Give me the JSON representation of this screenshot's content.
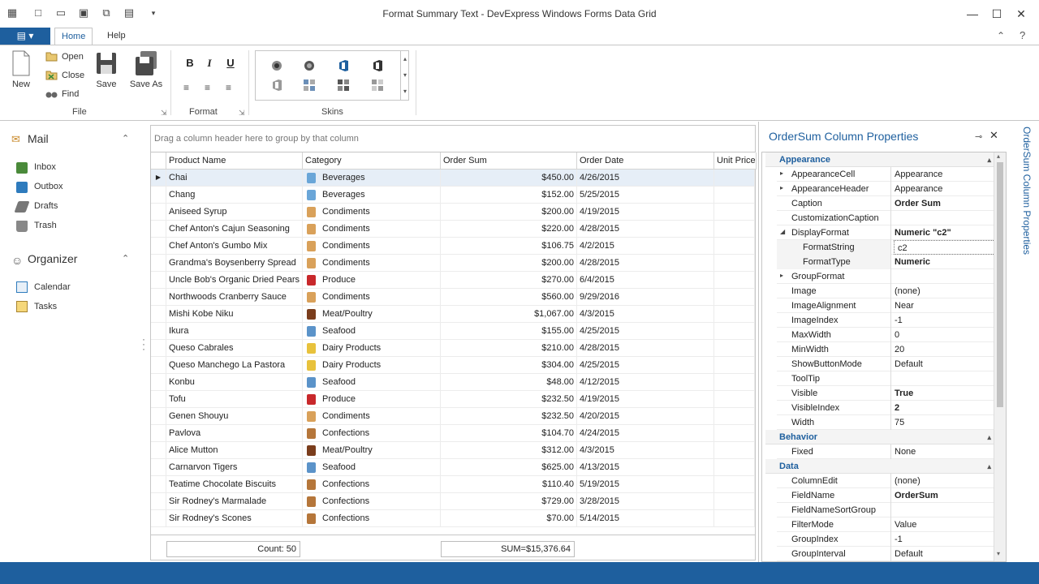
{
  "window": {
    "title": "Format Summary Text - DevExpress Windows Forms Data Grid"
  },
  "ribbon": {
    "file_label": "▤ ▾",
    "tabs": [
      "Home",
      "Help"
    ],
    "new_label": "New",
    "open_label": "Open",
    "close_label": "Close",
    "find_label": "Find",
    "save_label": "Save",
    "saveas_label": "Save As",
    "groups": {
      "file": "File",
      "format": "Format",
      "skins": "Skins"
    },
    "format_buttons": [
      "B",
      "I",
      "U"
    ]
  },
  "nav": {
    "mail": {
      "header": "Mail",
      "items": [
        "Inbox",
        "Outbox",
        "Drafts",
        "Trash"
      ]
    },
    "organizer": {
      "header": "Organizer",
      "items": [
        "Calendar",
        "Tasks"
      ]
    }
  },
  "grid": {
    "group_panel_text": "Drag a column header here to group by that column",
    "columns": [
      "Product Name",
      "Category",
      "Order Sum",
      "Order Date",
      "Unit Price"
    ],
    "rows": [
      {
        "name": "Chai",
        "category": "Beverages",
        "sum": "$450.00",
        "date": "4/26/2015"
      },
      {
        "name": "Chang",
        "category": "Beverages",
        "sum": "$152.00",
        "date": "5/25/2015"
      },
      {
        "name": "Aniseed Syrup",
        "category": "Condiments",
        "sum": "$200.00",
        "date": "4/19/2015"
      },
      {
        "name": "Chef Anton's Cajun Seasoning",
        "category": "Condiments",
        "sum": "$220.00",
        "date": "4/28/2015"
      },
      {
        "name": "Chef Anton's Gumbo Mix",
        "category": "Condiments",
        "sum": "$106.75",
        "date": "4/2/2015"
      },
      {
        "name": "Grandma's Boysenberry Spread",
        "category": "Condiments",
        "sum": "$200.00",
        "date": "4/28/2015"
      },
      {
        "name": "Uncle Bob's Organic Dried Pears",
        "category": "Produce",
        "sum": "$270.00",
        "date": "6/4/2015"
      },
      {
        "name": "Northwoods Cranberry Sauce",
        "category": "Condiments",
        "sum": "$560.00",
        "date": "9/29/2016"
      },
      {
        "name": "Mishi Kobe Niku",
        "category": "Meat/Poultry",
        "sum": "$1,067.00",
        "date": "4/3/2015"
      },
      {
        "name": "Ikura",
        "category": "Seafood",
        "sum": "$155.00",
        "date": "4/25/2015"
      },
      {
        "name": "Queso Cabrales",
        "category": "Dairy Products",
        "sum": "$210.00",
        "date": "4/28/2015"
      },
      {
        "name": "Queso Manchego La Pastora",
        "category": "Dairy Products",
        "sum": "$304.00",
        "date": "4/25/2015"
      },
      {
        "name": "Konbu",
        "category": "Seafood",
        "sum": "$48.00",
        "date": "4/12/2015"
      },
      {
        "name": "Tofu",
        "category": "Produce",
        "sum": "$232.50",
        "date": "4/19/2015"
      },
      {
        "name": "Genen Shouyu",
        "category": "Condiments",
        "sum": "$232.50",
        "date": "4/20/2015"
      },
      {
        "name": "Pavlova",
        "category": "Confections",
        "sum": "$104.70",
        "date": "4/24/2015"
      },
      {
        "name": "Alice Mutton",
        "category": "Meat/Poultry",
        "sum": "$312.00",
        "date": "4/3/2015"
      },
      {
        "name": "Carnarvon Tigers",
        "category": "Seafood",
        "sum": "$625.00",
        "date": "4/13/2015"
      },
      {
        "name": "Teatime Chocolate Biscuits",
        "category": "Confections",
        "sum": "$110.40",
        "date": "5/19/2015"
      },
      {
        "name": "Sir Rodney's Marmalade",
        "category": "Confections",
        "sum": "$729.00",
        "date": "3/28/2015"
      },
      {
        "name": "Sir Rodney's Scones",
        "category": "Confections",
        "sum": "$70.00",
        "date": "5/14/2015"
      }
    ],
    "footer": {
      "count": "Count: 50",
      "sum": "SUM=$15,376.64"
    },
    "category_colors": {
      "Beverages": "#6aa6d8",
      "Condiments": "#d9a15a",
      "Produce": "#c8282b",
      "Meat/Poultry": "#7a3d1c",
      "Seafood": "#5b93c9",
      "Dairy Products": "#e8c23c",
      "Confections": "#b5763a"
    }
  },
  "props": {
    "title": "OrderSum Column Properties",
    "vertical_tab": "OrderSum Column Properties",
    "categories": {
      "appearance": "Appearance",
      "behavior": "Behavior",
      "data": "Data"
    },
    "appearance_rows": [
      {
        "name": "AppearanceCell",
        "value": "Appearance",
        "bold": false,
        "expander": "▸"
      },
      {
        "name": "AppearanceHeader",
        "value": "Appearance",
        "bold": false,
        "expander": "▸"
      },
      {
        "name": "Caption",
        "value": "Order Sum",
        "bold": true,
        "expander": ""
      },
      {
        "name": "CustomizationCaption",
        "value": "",
        "bold": false,
        "expander": ""
      },
      {
        "name": "DisplayFormat",
        "value": "Numeric \"c2\"",
        "bold": true,
        "expander": "◢"
      },
      {
        "name": "FormatString",
        "value": "c2",
        "bold": false,
        "expander": "",
        "indent": true,
        "editing": true
      },
      {
        "name": "FormatType",
        "value": "Numeric",
        "bold": true,
        "expander": "",
        "indent": true
      },
      {
        "name": "GroupFormat",
        "value": "",
        "bold": false,
        "expander": "▸"
      },
      {
        "name": "Image",
        "value": "(none)",
        "bold": false,
        "expander": ""
      },
      {
        "name": "ImageAlignment",
        "value": "Near",
        "bold": false,
        "expander": ""
      },
      {
        "name": "ImageIndex",
        "value": "-1",
        "bold": false,
        "expander": ""
      },
      {
        "name": "MaxWidth",
        "value": "0",
        "bold": false,
        "expander": ""
      },
      {
        "name": "MinWidth",
        "value": "20",
        "bold": false,
        "expander": ""
      },
      {
        "name": "ShowButtonMode",
        "value": "Default",
        "bold": false,
        "expander": ""
      },
      {
        "name": "ToolTip",
        "value": "",
        "bold": false,
        "expander": ""
      },
      {
        "name": "Visible",
        "value": "True",
        "bold": true,
        "expander": ""
      },
      {
        "name": "VisibleIndex",
        "value": "2",
        "bold": true,
        "expander": ""
      },
      {
        "name": "Width",
        "value": "75",
        "bold": false,
        "expander": ""
      }
    ],
    "behavior_rows": [
      {
        "name": "Fixed",
        "value": "None",
        "bold": false,
        "expander": ""
      }
    ],
    "data_rows": [
      {
        "name": "ColumnEdit",
        "value": "(none)",
        "bold": false,
        "expander": ""
      },
      {
        "name": "FieldName",
        "value": "OrderSum",
        "bold": true,
        "expander": ""
      },
      {
        "name": "FieldNameSortGroup",
        "value": "",
        "bold": false,
        "expander": ""
      },
      {
        "name": "FilterMode",
        "value": "Value",
        "bold": false,
        "expander": ""
      },
      {
        "name": "GroupIndex",
        "value": "-1",
        "bold": false,
        "expander": ""
      },
      {
        "name": "GroupInterval",
        "value": "Default",
        "bold": false,
        "expander": ""
      }
    ]
  },
  "colors": {
    "accent": "#1e5f9e",
    "selected_row": "#e6eef7"
  }
}
